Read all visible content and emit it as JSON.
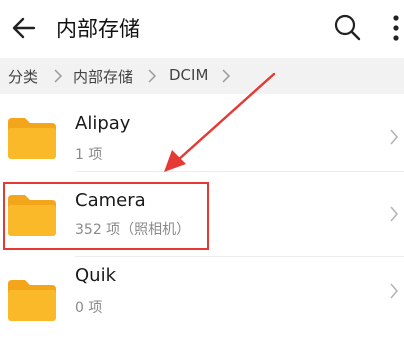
{
  "header": {
    "title": "内部存储",
    "back_icon": "back-arrow-icon",
    "search_icon": "search-icon",
    "more_icon": "more-vert-icon"
  },
  "breadcrumb": [
    "分类",
    "内部存储",
    "DCIM"
  ],
  "folders": [
    {
      "name": "Alipay",
      "meta": "1 项"
    },
    {
      "name": "Camera",
      "meta": "352 项（照相机）"
    },
    {
      "name": "Quik",
      "meta": "0 项"
    }
  ],
  "colors": {
    "folder": "#f9b928",
    "folder_tab": "#f3a61c",
    "annotation": "#e53935",
    "breadcrumb_bg": "#f2f2f2"
  }
}
